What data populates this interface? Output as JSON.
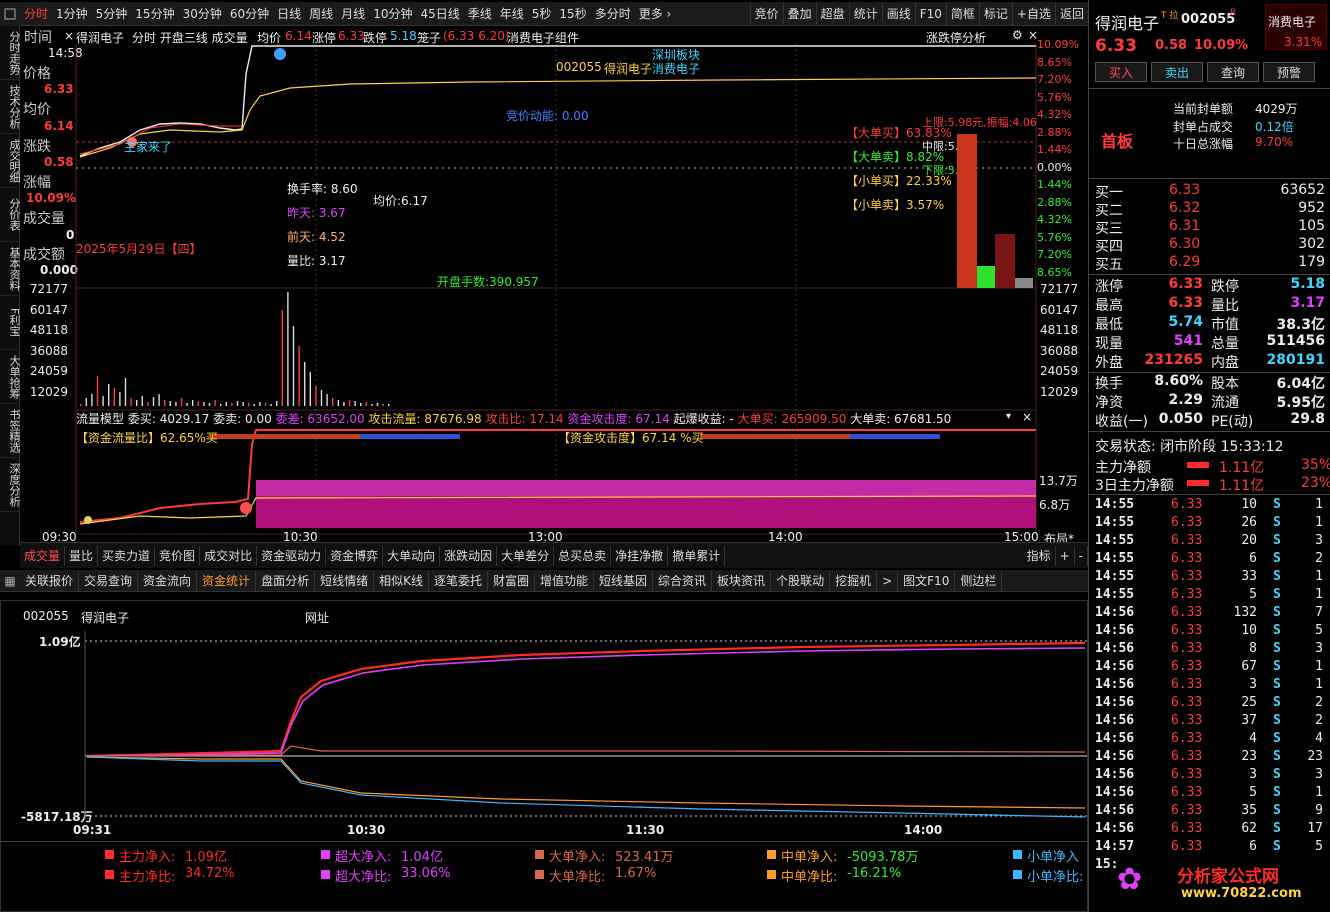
{
  "toolbar": {
    "periods": [
      "分时",
      "1分钟",
      "5分钟",
      "15分钟",
      "30分钟",
      "60分钟",
      "日线",
      "周线",
      "月线",
      "10分钟",
      "45日线",
      "季线",
      "年线",
      "5秒",
      "15秒",
      "多分时",
      "更多 ›"
    ],
    "right_items": [
      "竞价",
      "叠加",
      "超盘",
      "统计",
      "画线",
      "F10",
      "简框",
      "标记",
      "+自选",
      "返回"
    ]
  },
  "vtabs": [
    "分时走势",
    "技术分析",
    "成交明细",
    "分价表",
    "基本资料",
    "F利宝",
    "大单抢筹",
    "书签精选",
    "深度分析"
  ],
  "chart_header": {
    "name": "得润电子",
    "items": "分时 开盘三线 成交量",
    "avg_label": "均价",
    "avg_val": "6.14",
    "change_label": "涨停",
    "change_val": "6.33",
    "limit_down_label": "跌停",
    "limit_down_val": "5.18",
    "cage_label": "笼子",
    "cage_val": "(6.33 6.20)",
    "comp": "消费电子组件",
    "right_btn": "涨跌停分析"
  },
  "left_info": {
    "time_label": "时间",
    "time_val": "14:58",
    "price_label": "价格",
    "price_val": "6.33",
    "avg_label": "均价",
    "avg_val": "6.14",
    "chg_label": "涨跌",
    "chg_val": "0.58",
    "pct_label": "涨幅",
    "pct_val": "10.09%",
    "vol_label": "成交量",
    "vol_val": "0",
    "amt_label": "成交额",
    "amt_val": "0.000"
  },
  "price_axis_right": [
    "10.09%",
    "8.65%",
    "7.20%",
    "5.76%",
    "4.32%",
    "2.88%",
    "1.44%",
    "0.00%",
    "1.44%",
    "2.88%",
    "4.32%",
    "5.76%",
    "7.20%",
    "8.65%"
  ],
  "annotations": {
    "stock_code": "002055",
    "stock_name": "得润电子",
    "board": "深圳板块",
    "sector": "消费电子",
    "auction": "竞价动能: 0.00",
    "limit_up": "上限:5.98元,振幅:4.06",
    "mid": "中限:5.",
    "low": "下限:5.",
    "big_buy": "【大单买】63.83%",
    "big_sell": "【大单卖】8.82%",
    "small_buy": "【小单买】22.33%",
    "small_sell": "【小单卖】3.57%",
    "turnover": "换手率: 8.60",
    "avg_price": "均价:6.17",
    "yesterday": "昨天: 3.67",
    "daybefore": "前天: 4.52",
    "vol_ratio": "量比: 3.17",
    "date": "2025年5月29日【四】",
    "open_hands": "开盘手数:390.957",
    "main_coming": "主家来了"
  },
  "vol_axis": [
    "72177",
    "60147",
    "48118",
    "36088",
    "24059",
    "12029"
  ],
  "flow_header": {
    "model": "流量模型",
    "wb": "委买: 4029.17",
    "ws": "委卖: 0.00",
    "wc": "委差: 63652.00",
    "attack": "攻击流量: 87676.98",
    "attack_ratio": "攻击比: 17.14",
    "attack_deg": "资金攻击度: 67.14",
    "burst": "起爆收益: -",
    "big_buy": "大单买: 265909.50",
    "big_sell": "大单卖: 67681.50"
  },
  "flow_ratio": "【资金流量比】62.65%买",
  "flow_attack": "【资金攻击度】67.14 %买",
  "flow_axis": [
    "13.7万",
    "6.8万"
  ],
  "time_axis": [
    "09:30",
    "10:30",
    "13:00",
    "14:00",
    "15:00"
  ],
  "layout_btn": "布局*",
  "sub_tabs": [
    "成交量",
    "量比",
    "买卖力道",
    "竞价图",
    "成交对比",
    "资金驱动力",
    "资金博弈",
    "大单动向",
    "涨跌动因",
    "大单差分",
    "总买总卖",
    "净挂净撤",
    "撤单累计"
  ],
  "sub_right": [
    "指标",
    "+",
    "-"
  ],
  "bottom_tabs": [
    "关联报价",
    "交易查询",
    "资金流向",
    "资金统计",
    "盘面分析",
    "短线情绪",
    "相似K线",
    "逐笔委托",
    "财富圈",
    "增值功能",
    "短线基因",
    "综合资讯",
    "板块资讯",
    "个股联动",
    "挖掘机",
    ">",
    "图文F10",
    "侧边栏"
  ],
  "bottom_active": 3,
  "fund": {
    "code": "002055",
    "name": "得润电子",
    "url_label": "网址",
    "top_val": "1.09亿",
    "bottom_val": "-5817.18万",
    "times": [
      "09:31",
      "10:30",
      "11:30",
      "14:00"
    ],
    "legend1": [
      {
        "label": "主力净入:",
        "val": "1.09亿",
        "color": "#ff2a2a"
      },
      {
        "label": "超大净入:",
        "val": "1.04亿",
        "color": "#e040fb"
      },
      {
        "label": "大单净入:",
        "val": "523.41万",
        "color": "#d9684a"
      },
      {
        "label": "中单净入:",
        "val": "-5093.78万",
        "color": "#ff9b2a"
      },
      {
        "label": "小单净入",
        "val": "",
        "color": "#3fb7ff"
      }
    ],
    "legend2": [
      {
        "label": "主力净比:",
        "val": "34.72%",
        "color": "#ff2a2a"
      },
      {
        "label": "超大净比:",
        "val": "33.06%",
        "color": "#e040fb"
      },
      {
        "label": "大单净比:",
        "val": "1.67%",
        "color": "#d9684a"
      },
      {
        "label": "中单净比:",
        "val": "-16.21%",
        "color": "#ff9b2a"
      },
      {
        "label": "小单净比:",
        "val": "",
        "color": "#3fb7ff"
      }
    ]
  },
  "right_panel": {
    "name": "得润电子",
    "marks": "T 拉",
    "code": "002055",
    "r": "R",
    "sector": "消费电子",
    "sector_pct": "3.31%",
    "price": "6.33",
    "chg": "0.58",
    "pct": "10.09%",
    "btn_buy": "买入",
    "btn_sell": "卖出",
    "btn_query": "查询",
    "btn_alert": "预警",
    "first_board": "首板",
    "seal_label": "当前封单额",
    "seal_val": "4029万",
    "seal_ratio_label": "封单占成交",
    "seal_ratio_val": "0.12倍",
    "ten_label": "十日总涨幅",
    "ten_val": "9.70%",
    "bids": [
      {
        "label": "买一",
        "price": "6.33",
        "vol": "63652"
      },
      {
        "label": "买二",
        "price": "6.32",
        "vol": "952"
      },
      {
        "label": "买三",
        "price": "6.31",
        "vol": "105"
      },
      {
        "label": "买四",
        "price": "6.30",
        "vol": "302"
      },
      {
        "label": "买五",
        "price": "6.29",
        "vol": "179"
      }
    ],
    "stats": [
      {
        "l1": "涨停",
        "v1": "6.33",
        "l2": "跌停",
        "v2": "5.18"
      },
      {
        "l1": "最高",
        "v1": "6.33",
        "l2": "量比",
        "v2": "3.17"
      },
      {
        "l1": "最低",
        "v1": "5.74",
        "l2": "市值",
        "v2": "38.3亿"
      },
      {
        "l1": "现量",
        "v1": "541",
        "l2": "总量",
        "v2": "511456"
      },
      {
        "l1": "外盘",
        "v1": "231265",
        "l2": "内盘",
        "v2": "280191"
      }
    ],
    "stats2": [
      {
        "l1": "换手",
        "v1": "8.60%",
        "l2": "股本",
        "v2": "6.04亿"
      },
      {
        "l1": "净资",
        "v1": "2.29",
        "l2": "流通",
        "v2": "5.95亿"
      },
      {
        "l1": "收益(一)",
        "v1": "0.050",
        "l2": "PE(动)",
        "v2": "29.8"
      }
    ],
    "trade_status": "交易状态: 闭市阶段 15:33:12",
    "main_net_label": "主力净额",
    "main_net_val": "1.11亿",
    "main_net_pct": "35%",
    "main3_label": "3日主力净额",
    "main3_val": "1.11亿",
    "main3_pct": "23%",
    "ticks": [
      [
        "14:55",
        "6.33",
        "10",
        "S",
        "1"
      ],
      [
        "14:55",
        "6.33",
        "26",
        "S",
        "1"
      ],
      [
        "14:55",
        "6.33",
        "20",
        "S",
        "3"
      ],
      [
        "14:55",
        "6.33",
        "6",
        "S",
        "2"
      ],
      [
        "14:55",
        "6.33",
        "33",
        "S",
        "1"
      ],
      [
        "14:55",
        "6.33",
        "5",
        "S",
        "1"
      ],
      [
        "14:56",
        "6.33",
        "132",
        "S",
        "7"
      ],
      [
        "14:56",
        "6.33",
        "10",
        "S",
        "5"
      ],
      [
        "14:56",
        "6.33",
        "8",
        "S",
        "3"
      ],
      [
        "14:56",
        "6.33",
        "67",
        "S",
        "1"
      ],
      [
        "14:56",
        "6.33",
        "3",
        "S",
        "1"
      ],
      [
        "14:56",
        "6.33",
        "25",
        "S",
        "2"
      ],
      [
        "14:56",
        "6.33",
        "37",
        "S",
        "2"
      ],
      [
        "14:56",
        "6.33",
        "4",
        "S",
        "4"
      ],
      [
        "14:56",
        "6.33",
        "23",
        "S",
        "23"
      ],
      [
        "14:56",
        "6.33",
        "3",
        "S",
        "3"
      ],
      [
        "14:56",
        "6.33",
        "5",
        "S",
        "1"
      ],
      [
        "14:56",
        "6.33",
        "35",
        "S",
        "9"
      ],
      [
        "14:56",
        "6.33",
        "62",
        "S",
        "17"
      ],
      [
        "14:57",
        "6.33",
        "6",
        "S",
        "5"
      ],
      [
        "15:0",
        "",
        "",
        "",
        ""
      ]
    ]
  },
  "watermark": "分析家公式网www.70822.com",
  "logo": {
    "line1": "分析家公式网",
    "line2": "www.70822.com"
  }
}
